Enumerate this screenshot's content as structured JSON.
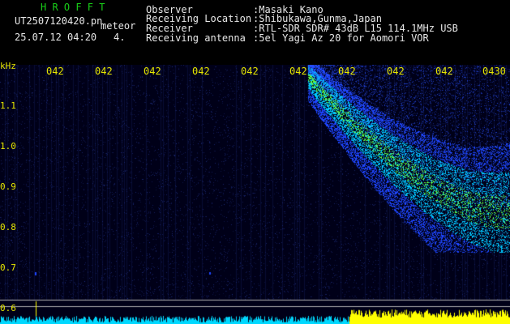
{
  "header": {
    "app_title": "H R O F F T",
    "filename": "UT2507120420.pn",
    "meteor_label": "meteor",
    "datetime": "25.07.12 04:20",
    "counter": "4.",
    "fields": [
      {
        "label": "Observer",
        "value": ":Masaki Kano"
      },
      {
        "label": "Receiving Location",
        "value": ":Shibukawa,Gunma,Japan"
      },
      {
        "label": "Receiver",
        "value": ":RTL-SDR SDR# 43dB L15 114.1MHz USB"
      },
      {
        "label": "Receiving antenna",
        "value": ":5el Yagi Az 20 for Aomori VOR"
      }
    ]
  },
  "axis": {
    "unit": "kHz",
    "y_labels": [
      "1.1",
      "1.0",
      "0.9",
      "0.8",
      "0.7",
      "0.6"
    ],
    "time_ticks": [
      "042",
      "042",
      "042",
      "042",
      "042",
      "042",
      "042",
      "042",
      "042",
      "0430"
    ]
  },
  "colors": {
    "header_green": "#19d019",
    "axis_yellow": "#e6e600",
    "spectrum_bg": "#000018",
    "signal_blue": "#1e46ff",
    "signal_cyan": "#00c8ff",
    "signal_green": "#60ff40",
    "level_cyan": "#00d8ff",
    "level_yellow": "#ffff00"
  }
}
